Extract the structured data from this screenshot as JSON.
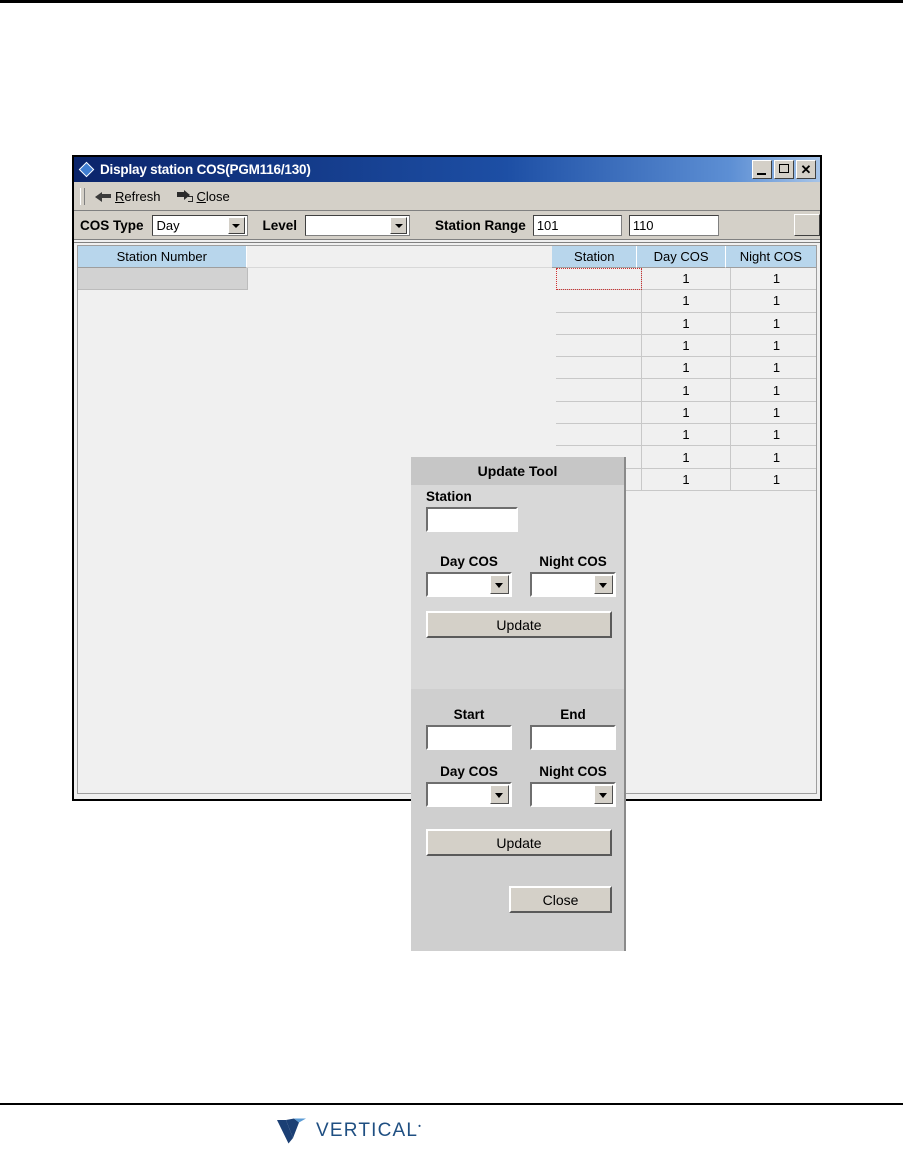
{
  "page": {
    "brand_name": "VERTICAL",
    "brand_tm": "•"
  },
  "window": {
    "title": "Display station COS(PGM116/130)",
    "title_icon": "diamond-icon",
    "minimize_label": "",
    "maximize_label": "",
    "close_label": "✕"
  },
  "toolbar": {
    "items": [
      {
        "icon": "arrow-left-icon",
        "label_pre": "",
        "label_mnemonic": "R",
        "label_post": "efresh",
        "name": "refresh"
      },
      {
        "icon": "exit-door-icon",
        "label_pre": "",
        "label_mnemonic": "C",
        "label_post": "lose",
        "name": "close"
      }
    ]
  },
  "filterbar": {
    "cos_type_label": "COS Type",
    "cos_type_value": "Day",
    "level_label": "Level",
    "level_value": "",
    "station_range_label": "Station Range",
    "station_range_from": "101",
    "station_range_to": "110"
  },
  "grid": {
    "headers": [
      {
        "label": "Station Number",
        "key": "station_number"
      },
      {
        "label": "Station",
        "key": "station"
      },
      {
        "label": "Day COS",
        "key": "day_cos"
      },
      {
        "label": "Night COS",
        "key": "night_cos"
      }
    ],
    "rows": [
      {
        "station": "",
        "day_cos": "1",
        "night_cos": "1"
      },
      {
        "station": "",
        "day_cos": "1",
        "night_cos": "1"
      },
      {
        "station": "",
        "day_cos": "1",
        "night_cos": "1"
      },
      {
        "station": "",
        "day_cos": "1",
        "night_cos": "1"
      },
      {
        "station": "",
        "day_cos": "1",
        "night_cos": "1"
      },
      {
        "station": "",
        "day_cos": "1",
        "night_cos": "1"
      },
      {
        "station": "",
        "day_cos": "1",
        "night_cos": "1"
      },
      {
        "station": "",
        "day_cos": "1",
        "night_cos": "1"
      },
      {
        "station": "",
        "day_cos": "1",
        "night_cos": "1"
      },
      {
        "station": "",
        "day_cos": "1",
        "night_cos": "1"
      }
    ]
  },
  "update_tool": {
    "title": "Update Tool",
    "single": {
      "station_label": "Station",
      "station_value": "",
      "day_cos_label": "Day COS",
      "day_cos_value": "",
      "night_cos_label": "Night COS",
      "night_cos_value": "",
      "update_label": "Update"
    },
    "range": {
      "start_label": "Start",
      "start_value": "",
      "end_label": "End",
      "end_value": "",
      "day_cos_label": "Day COS",
      "day_cos_value": "",
      "night_cos_label": "Night COS",
      "night_cos_value": "",
      "update_label": "Update"
    },
    "close_label": "Close"
  },
  "colors": {
    "titlebar_start": "#0a246a",
    "titlebar_end": "#a6c4e8",
    "header_cell": "#b8d6ec",
    "dialog_face": "#d4d0c8",
    "panel_top": "#d8d8d8",
    "panel_bottom": "#cfcfcf",
    "focus_outline": "#d03030",
    "brand_blue": "#1f4f82"
  }
}
